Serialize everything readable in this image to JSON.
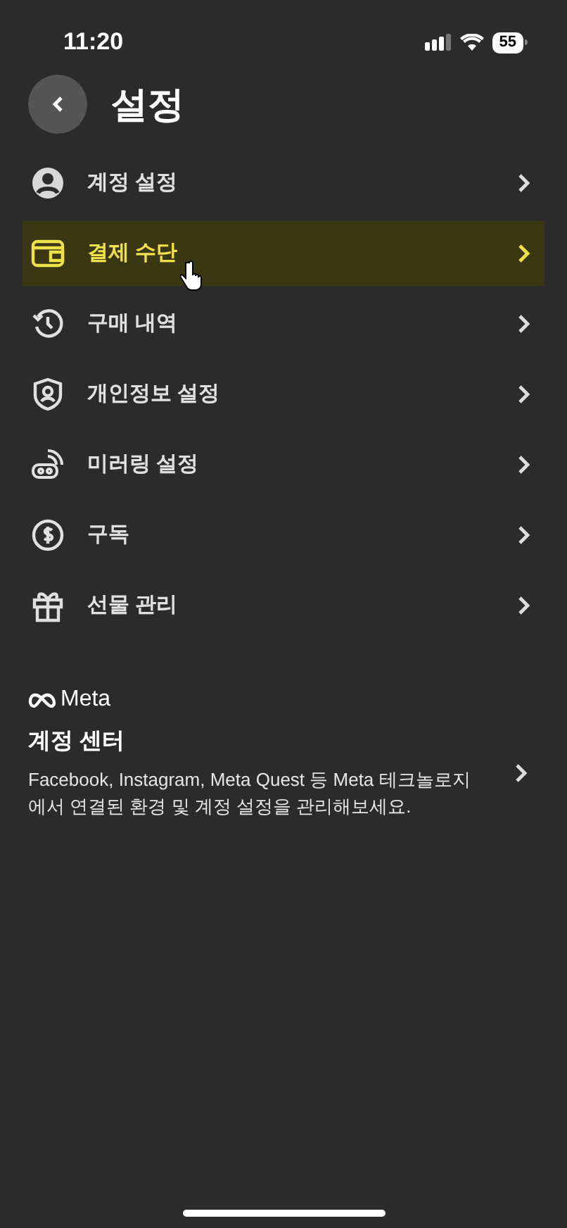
{
  "status_bar": {
    "time": "11:20",
    "battery": "55"
  },
  "header": {
    "title": "설정"
  },
  "menu_items": [
    {
      "label": "계정 설정",
      "selected": false
    },
    {
      "label": "결제 수단",
      "selected": true
    },
    {
      "label": "구매 내역",
      "selected": false
    },
    {
      "label": "개인정보 설정",
      "selected": false
    },
    {
      "label": "미러링 설정",
      "selected": false
    },
    {
      "label": "구독",
      "selected": false
    },
    {
      "label": "선물 관리",
      "selected": false
    }
  ],
  "meta_section": {
    "brand": "Meta",
    "title": "계정 센터",
    "description": "Facebook, Instagram, Meta Quest 등 Meta 테크놀로지에서 연결된 환경 및 계정 설정을 관리해보세요."
  }
}
